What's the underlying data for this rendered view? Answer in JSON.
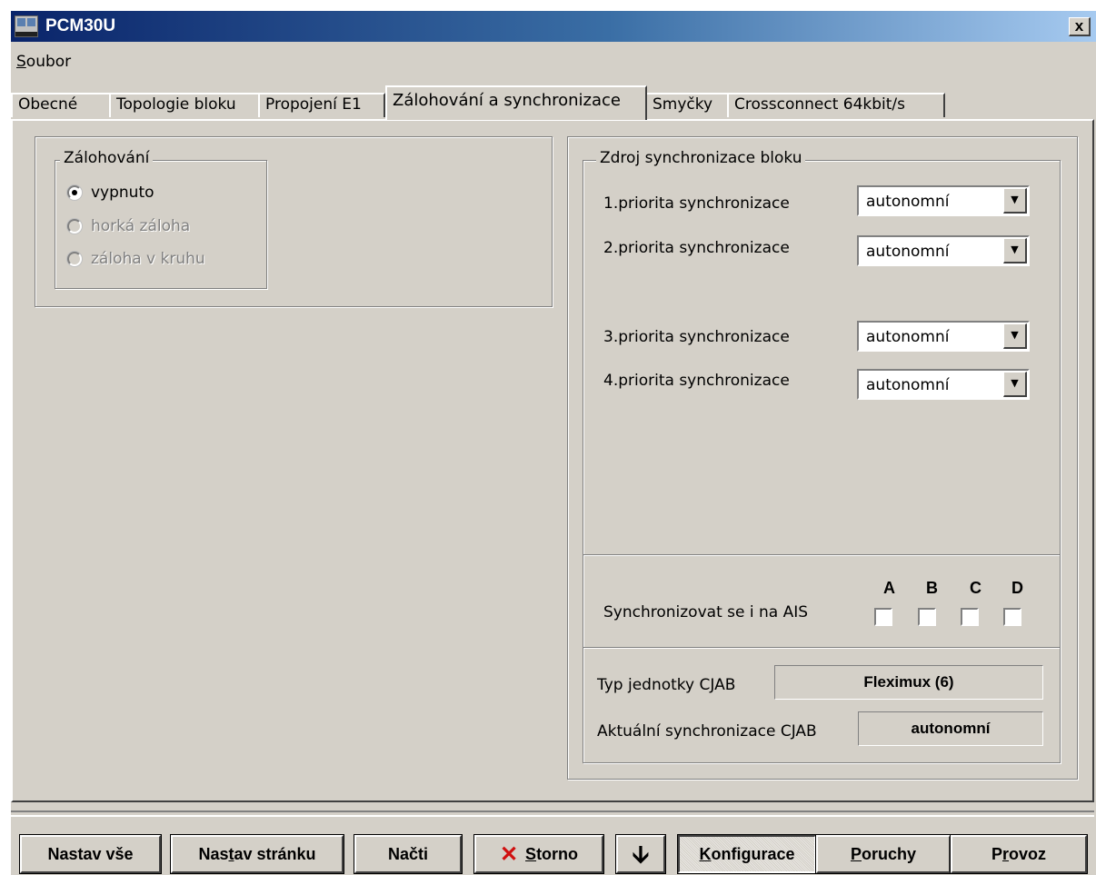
{
  "window": {
    "title": "PCM30U",
    "close_label": "x"
  },
  "menu": {
    "file_first": "S",
    "file_rest": "oubor"
  },
  "tabs": [
    {
      "label": "Obecné"
    },
    {
      "label": "Topologie bloku"
    },
    {
      "label": "Propojení E1"
    },
    {
      "label": "Zálohování a synchronizace",
      "active": true
    },
    {
      "label": "Smyčky"
    },
    {
      "label": "Crossconnect 64kbit/s"
    }
  ],
  "backup": {
    "title": "Zálohování",
    "options": [
      {
        "label": "vypnuto",
        "selected": true,
        "enabled": true
      },
      {
        "label": "horká záloha",
        "selected": false,
        "enabled": false
      },
      {
        "label": "záloha v kruhu",
        "selected": false,
        "enabled": false
      }
    ]
  },
  "sync": {
    "title": "Zdroj synchronizace bloku",
    "priorities": [
      {
        "label": "1.priorita synchronizace",
        "value": "autonomní"
      },
      {
        "label": "2.priorita synchronizace",
        "value": "autonomní"
      },
      {
        "label": "3.priorita synchronizace",
        "value": "autonomní"
      },
      {
        "label": "4.priorita synchronizace",
        "value": "autonomní"
      }
    ],
    "ais_label": "Synchronizovat se i na AIS",
    "ais_columns": [
      {
        "letter": "A",
        "checked": false
      },
      {
        "letter": "B",
        "checked": false
      },
      {
        "letter": "C",
        "checked": false
      },
      {
        "letter": "D",
        "checked": false
      }
    ],
    "unit_type_label": "Typ jednotky CJAB",
    "unit_type_value": "Fleximux (6)",
    "current_sync_label": "Aktuální synchronizace CJAB",
    "current_sync_value": "autonomní"
  },
  "buttons": {
    "set_all": "Nastav vše",
    "set_page_a": "Nas",
    "set_page_u": "t",
    "set_page_b": "av stránku",
    "load": "Načti",
    "cancel_u": "S",
    "cancel_rest": "torno",
    "config_u": "K",
    "config_rest": "onfigurace",
    "faults_u": "P",
    "faults_rest": "oruchy",
    "operation_a": "P",
    "operation_u": "r",
    "operation_b": "ovoz"
  },
  "colors": {
    "face": "#d4d0c8",
    "title_start": "#0a246a",
    "title_end": "#a6caf0",
    "cancel_icon": "#d01010"
  }
}
